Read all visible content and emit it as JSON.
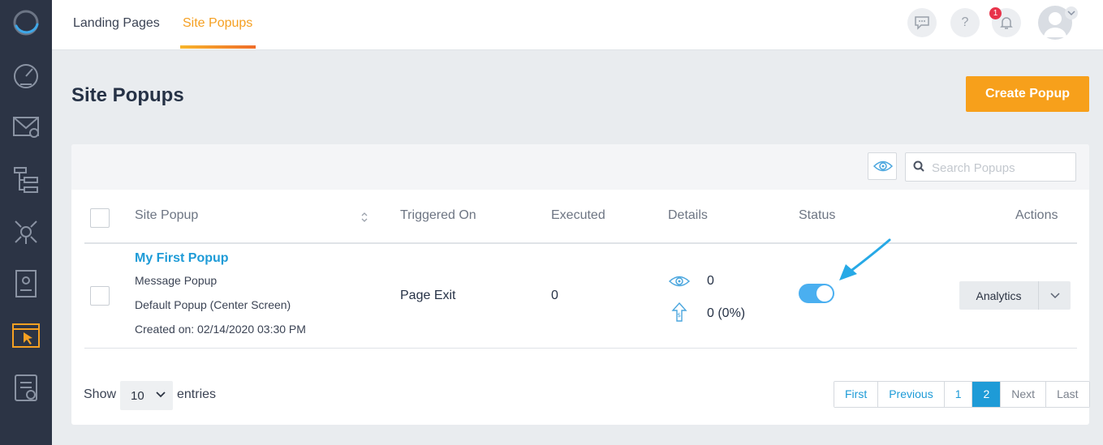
{
  "nav": {
    "tabs": [
      {
        "label": "Landing Pages"
      },
      {
        "label": "Site Popups"
      }
    ],
    "notification_count": "1"
  },
  "page": {
    "title": "Site Popups",
    "create_button": "Create Popup"
  },
  "search": {
    "placeholder": "Search Popups"
  },
  "table": {
    "columns": [
      "Site Popup",
      "Triggered On",
      "Executed",
      "Details",
      "Status",
      "Actions"
    ],
    "rows": [
      {
        "name": "My First Popup",
        "type": "Message Popup",
        "template": "Default Popup (Center Screen)",
        "created": "Created on: 02/14/2020 03:30 PM",
        "triggered_on": "Page Exit",
        "executed": "0",
        "views": "0",
        "conversions": "0 (0%)",
        "status_enabled": true,
        "action_label": "Analytics"
      }
    ]
  },
  "footer": {
    "show_label": "Show",
    "entries_value": "10",
    "entries_label": "entries",
    "pagination": [
      "First",
      "Previous",
      "1",
      "2",
      "Next",
      "Last"
    ],
    "current_page": "2"
  },
  "colors": {
    "sidebar": "#2c3445",
    "accent_orange": "#f7a01b",
    "link_blue": "#1e9bd7",
    "toggle_on": "#4aaff0"
  },
  "icons": [
    "speedometer-icon",
    "mail-check-icon",
    "flow-icon",
    "network-icon",
    "contact-card-icon",
    "popup-cursor-icon",
    "checklist-icon"
  ]
}
